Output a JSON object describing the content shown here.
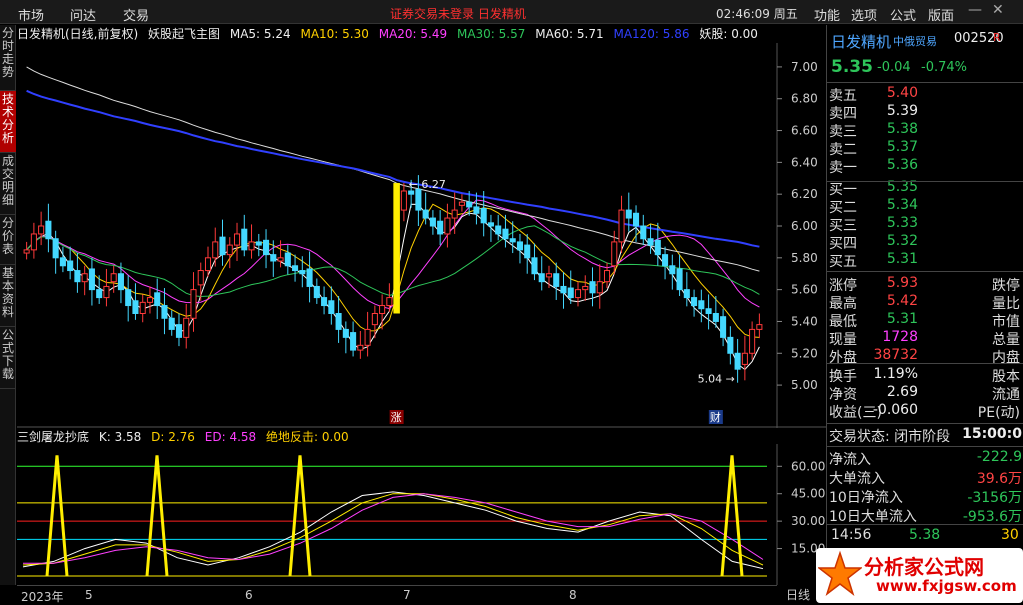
{
  "menu": {
    "market": "市场",
    "ask": "问达",
    "trade": "交易",
    "notice": "证券交易未登录  日发精机",
    "clock": "02:46:09 周五",
    "func": "功能",
    "options": "选项",
    "formula": "公式",
    "layout": "版面"
  },
  "sidetabs": [
    "分时走势",
    "技术分析",
    "成交明细",
    "分价表",
    "基本资料",
    "公式下载"
  ],
  "main_header": {
    "name": "日发精机(日线,前复权)",
    "indicator": "妖股起飞主图",
    "ma5": "MA5: 5.24",
    "ma10": "MA10: 5.30",
    "ma20": "MA20: 5.49",
    "ma30": "MA30: 5.57",
    "ma60": "MA60: 5.71",
    "ma120": "MA120: 5.86",
    "yaogu": "妖股: 0.00"
  },
  "sub_header": {
    "name": "三剑屠龙抄底",
    "k": "K: 3.58",
    "d": "D: 2.76",
    "ed": "ED: 4.58",
    "jd": "绝地反击: 0.00"
  },
  "xaxis": {
    "year": "2023年",
    "m5": "5",
    "m6": "6",
    "m7": "7",
    "m8": "8",
    "mode": "日线"
  },
  "marks": {
    "high": "6.27",
    "low": "5.04",
    "zhang": "涨",
    "cai": "财"
  },
  "stock": {
    "name": "日发精机",
    "tag": "中俄贸易",
    "code": "002520",
    "flag": "R",
    "price": "5.35",
    "change": "-0.04",
    "pct": "-0.74%"
  },
  "orderbook": [
    {
      "k": "卖五",
      "v": "5.40",
      "c": "red"
    },
    {
      "k": "卖四",
      "v": "5.39",
      "c": "white"
    },
    {
      "k": "卖三",
      "v": "5.38",
      "c": "green"
    },
    {
      "k": "卖二",
      "v": "5.37",
      "c": "green"
    },
    {
      "k": "卖一",
      "v": "5.36",
      "c": "green"
    },
    {
      "k": "买一",
      "v": "5.35",
      "c": "green"
    },
    {
      "k": "买二",
      "v": "5.34",
      "c": "green"
    },
    {
      "k": "买三",
      "v": "5.33",
      "c": "green"
    },
    {
      "k": "买四",
      "v": "5.32",
      "c": "green"
    },
    {
      "k": "买五",
      "v": "5.31",
      "c": "green"
    }
  ],
  "stats": [
    {
      "k": "涨停",
      "v": "5.93",
      "c": "red",
      "k2": "跌停"
    },
    {
      "k": "最高",
      "v": "5.42",
      "c": "red",
      "k2": "量比"
    },
    {
      "k": "最低",
      "v": "5.31",
      "c": "green",
      "k2": "市值"
    },
    {
      "k": "现量",
      "v": "1728",
      "c": "mag",
      "k2": "总量"
    },
    {
      "k": "外盘",
      "v": "38732",
      "c": "red",
      "k2": "内盘"
    }
  ],
  "stats2": [
    {
      "k": "换手",
      "v": "1.19%",
      "k2": "股本"
    },
    {
      "k": "净资",
      "v": "2.69",
      "k2": "流通"
    },
    {
      "k": "收益(三)",
      "v": "-0.060",
      "k2": "PE(动)"
    }
  ],
  "trade_status": {
    "label": "交易状态: 闭市阶段",
    "time": "15:00:0"
  },
  "flows": [
    {
      "k": "净流入",
      "v": "-222.9"
    },
    {
      "k": "大单流入",
      "v": "39.6万",
      "c": "red"
    },
    {
      "k": "10日净流入",
      "v": "-3156万"
    },
    {
      "k": "10日大单流入",
      "v": "-953.6万"
    }
  ],
  "tick": {
    "time": "14:56",
    "price": "5.38",
    "vol": "30"
  },
  "logo": {
    "cn": "分析家公式网",
    "url": "www.fxjgsw.com"
  },
  "chart_data": [
    {
      "type": "candlestick",
      "title": "日发精机(日线,前复权)",
      "ylim": [
        4.9,
        7.1
      ],
      "yticks": [
        5.0,
        5.2,
        5.4,
        5.6,
        5.8,
        6.0,
        6.2,
        6.4,
        6.6,
        6.8,
        7.0
      ],
      "close": [
        5.85,
        5.95,
        6.0,
        5.92,
        5.8,
        5.75,
        5.72,
        5.65,
        5.7,
        5.6,
        5.55,
        5.62,
        5.7,
        5.6,
        5.5,
        5.45,
        5.52,
        5.55,
        5.5,
        5.42,
        5.35,
        5.3,
        5.42,
        5.6,
        5.72,
        5.8,
        5.9,
        5.82,
        5.88,
        5.95,
        5.85,
        5.9,
        5.88,
        5.82,
        5.78,
        5.8,
        5.75,
        5.72,
        5.7,
        5.62,
        5.55,
        5.5,
        5.45,
        5.35,
        5.3,
        5.22,
        5.25,
        5.35,
        5.45,
        5.5,
        5.55,
        6.1,
        6.22,
        6.2,
        6.1,
        6.05,
        6.0,
        5.95,
        6.05,
        6.1,
        6.15,
        6.12,
        6.08,
        6.02,
        6.0,
        5.95,
        5.92,
        5.9,
        5.85,
        5.8,
        5.7,
        5.65,
        5.7,
        5.62,
        5.58,
        5.55,
        5.6,
        5.62,
        5.58,
        5.65,
        5.72,
        5.9,
        6.1,
        6.05,
        6.0,
        5.92,
        5.88,
        5.82,
        5.75,
        5.7,
        5.6,
        5.55,
        5.5,
        5.48,
        5.45,
        5.4,
        5.3,
        5.2,
        5.1,
        5.2,
        5.35,
        5.38
      ],
      "ma": [
        {
          "name": "MA5",
          "value": 5.24,
          "color": "#ffffff"
        },
        {
          "name": "MA10",
          "value": 5.3,
          "color": "#ffd000"
        },
        {
          "name": "MA20",
          "value": 5.49,
          "color": "#ff40ff"
        },
        {
          "name": "MA30",
          "value": 5.57,
          "color": "#2ec55a"
        },
        {
          "name": "MA60",
          "value": 5.71,
          "color": "#dddddd"
        },
        {
          "name": "MA120",
          "value": 5.86,
          "color": "#3040ff"
        }
      ]
    },
    {
      "type": "line",
      "title": "三剑屠龙抄底",
      "ylim": [
        0,
        70
      ],
      "yticks": [
        15,
        30,
        45,
        60
      ],
      "levels": [
        0,
        20,
        30,
        40,
        60
      ],
      "series": [
        {
          "name": "K",
          "values": [
            5,
            8,
            15,
            20,
            18,
            10,
            6,
            10,
            16,
            24,
            35,
            44,
            46,
            44,
            40,
            36,
            30,
            26,
            24,
            30,
            35,
            33,
            20,
            8,
            4
          ]
        },
        {
          "name": "D",
          "values": [
            6,
            7,
            12,
            17,
            17,
            13,
            8,
            9,
            14,
            21,
            30,
            40,
            45,
            45,
            42,
            38,
            32,
            28,
            25,
            28,
            33,
            34,
            26,
            14,
            6
          ]
        },
        {
          "name": "ED",
          "values": [
            7,
            7,
            10,
            14,
            16,
            14,
            10,
            9,
            12,
            18,
            26,
            36,
            43,
            45,
            43,
            40,
            35,
            30,
            27,
            27,
            31,
            34,
            30,
            20,
            9
          ]
        }
      ],
      "spikes": [
        2,
        9,
        17,
        44
      ]
    }
  ]
}
